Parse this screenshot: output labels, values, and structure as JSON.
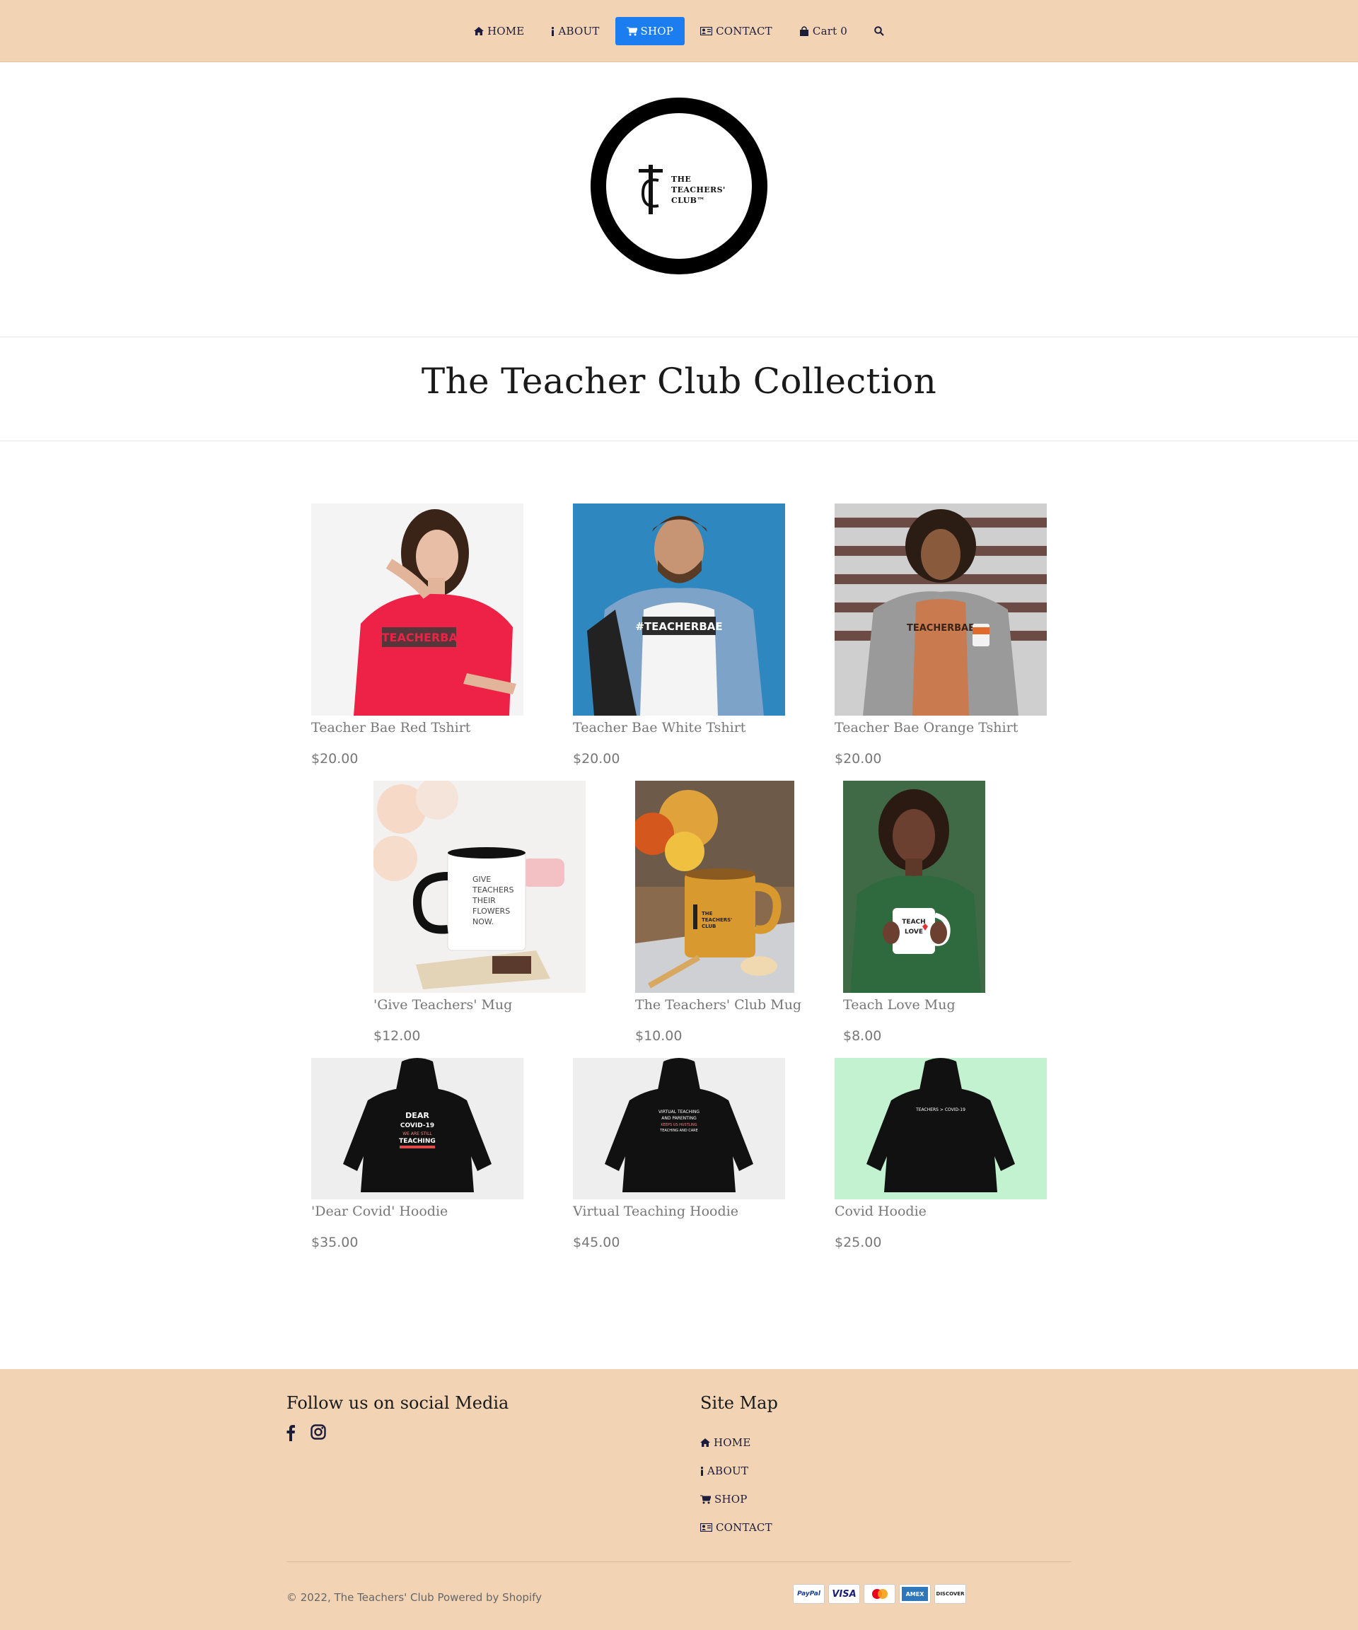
{
  "nav": {
    "home": "HOME",
    "about": "ABOUT",
    "shop": "SHOP",
    "contact": "CONTACT",
    "cart": "Cart 0",
    "active": "SHOP",
    "active_color": "#1c7df0"
  },
  "logo": {
    "lines": [
      "THE",
      "TEACHERS'",
      "CLUB™"
    ]
  },
  "collection": {
    "title": "The Teacher Club Collection"
  },
  "products": [
    {
      "title": "Teacher Bae Red Tshirt",
      "price": "$20.00",
      "image_text": "#TEACHERBAE"
    },
    {
      "title": "Teacher Bae White Tshirt",
      "price": "$20.00",
      "image_text": "#TEACHERBAE"
    },
    {
      "title": "Teacher Bae Orange Tshirt",
      "price": "$20.00",
      "image_text": "TEACHERBAE"
    },
    {
      "title": "'Give Teachers' Mug",
      "price": "$12.00",
      "image_text": "GIVE TEACHERS THEIR FLOWERS NOW."
    },
    {
      "title": "The Teachers' Club Mug",
      "price": "$10.00",
      "image_text": "THE TEACHERS' CLUB"
    },
    {
      "title": "Teach Love Mug",
      "price": "$8.00",
      "image_text": "TEACH LOVE"
    },
    {
      "title": "'Dear Covid' Hoodie",
      "price": "$35.00",
      "image_text": "DEAR COVID-19 WE ARE STILL TEACHING"
    },
    {
      "title": "Virtual Teaching Hoodie",
      "price": "$45.00",
      "image_text": "VIRTUAL TEACHING AND PARENTING"
    },
    {
      "title": "Covid Hoodie",
      "price": "$25.00",
      "image_text": "TEACHERS > COVID-19"
    }
  ],
  "footer": {
    "social_heading": "Follow us on social Media",
    "sitemap_heading": "Site Map",
    "sitemap": {
      "home": "HOME",
      "about": "ABOUT",
      "shop": "SHOP",
      "contact": "CONTACT"
    },
    "copyright": "© 2022, The Teachers' Club Powered by Shopify",
    "payments": [
      "PayPal",
      "VISA",
      "Mastercard",
      "AMEX",
      "DISCOVER"
    ]
  },
  "colors": {
    "header_bg": "#f2d4b5",
    "footer_bg": "#f2d4b5",
    "nav_text": "#1c1c3c"
  }
}
